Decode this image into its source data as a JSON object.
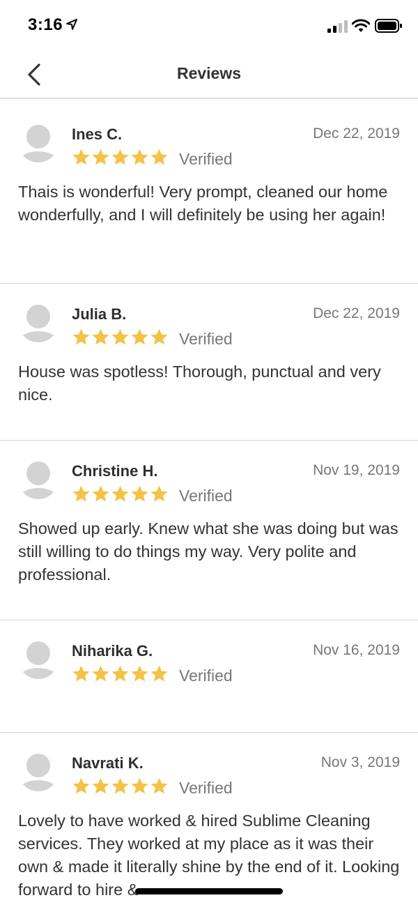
{
  "status_bar": {
    "time": "3:16"
  },
  "header": {
    "title": "Reviews"
  },
  "colors": {
    "star": "#F4C245",
    "avatar": "#D3D3D3"
  },
  "reviews": [
    {
      "name": "Ines C.",
      "date": "Dec 22, 2019",
      "rating": 5,
      "badge": "Verified",
      "text": "Thais is wonderful! Very prompt, cleaned our home wonderfully, and I will definitely be using her again!"
    },
    {
      "name": "Julia B.",
      "date": "Dec 22, 2019",
      "rating": 5,
      "badge": "Verified",
      "text": "House was spotless! Thorough, punctual and very nice."
    },
    {
      "name": "Christine H.",
      "date": "Nov 19, 2019",
      "rating": 5,
      "badge": "Verified",
      "text": "Showed up early. Knew what she was doing but was still willing to do things my way. Very polite and professional."
    },
    {
      "name": "Niharika G.",
      "date": "Nov 16, 2019",
      "rating": 5,
      "badge": "Verified",
      "text": ""
    },
    {
      "name": "Navrati K.",
      "date": "Nov 3, 2019",
      "rating": 5,
      "badge": "Verified",
      "text": "Lovely to have worked & hired Sublime Cleaning services. They worked at my place as it was their own & made it literally shine by the end of it. Looking forward to hire &"
    }
  ]
}
